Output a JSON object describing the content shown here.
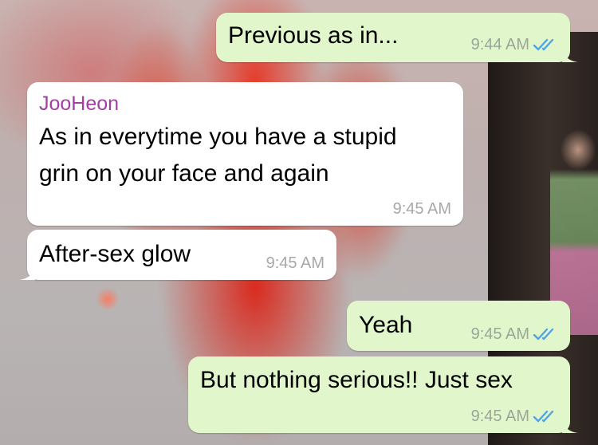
{
  "conversation": {
    "messages": [
      {
        "direction": "outgoing",
        "text": "Previous as in...",
        "time": "9:44 AM",
        "status_icon": "double-check-icon"
      },
      {
        "direction": "incoming",
        "sender": "JooHeon",
        "text_lines": [
          "As in everytime you have a stupid",
          "grin on your face and again"
        ],
        "time": "9:45 AM"
      },
      {
        "direction": "incoming",
        "text": "After-sex glow",
        "time": "9:45 AM"
      },
      {
        "direction": "outgoing",
        "text": "Yeah",
        "time": "9:45 AM",
        "status_icon": "double-check-icon"
      },
      {
        "direction": "outgoing",
        "text": "But nothing serious!! Just sex",
        "time": "9:45 AM",
        "status_icon": "double-check-icon"
      }
    ]
  },
  "colors": {
    "outgoing_bubble": "#e1f7cb",
    "incoming_bubble": "#ffffff",
    "sender_name": "#a23fa3",
    "read_ticks": "#4fa3e6"
  }
}
